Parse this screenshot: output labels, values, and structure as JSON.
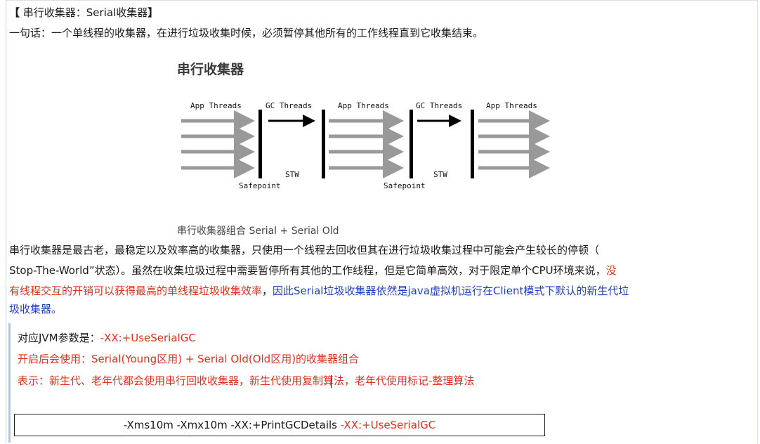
{
  "heading": {
    "bracket_open": "【",
    "text": " 串行收集器：Serial收集器",
    "bracket_close": "】"
  },
  "oneliner": "一句话：一个单线程的收集器，在进行垃圾收集时候，必须暂停其他所有的工作线程直到它收集结束。",
  "figure": {
    "title": "串行收集器",
    "caption": "串行收集器组合 Serial + Serial Old",
    "labels": {
      "app1": "App Threads",
      "gc1": "GC Threads",
      "app2": "App Threads",
      "gc2": "GC Threads",
      "app3": "App Threads",
      "stw1": "STW",
      "stw2": "STW",
      "safepoint1": "Safepoint",
      "safepoint2": "Safepoint"
    },
    "colors": {
      "app_arrow": "#999999",
      "gc_arrow": "#000000",
      "barrier": "#000000"
    }
  },
  "paragraph": {
    "line1": "串行收集器是最古老，最稳定以及效率高的收集器，只使用一个线程去回收但其在进行垃圾收集过程中可能会产生较长的停顿（",
    "line2_black": "Stop-The-World”状态）。虽然在收集垃圾过程中需要暂停所有其他的工作线程，但是它简单高效，对于限定单个CPU环境来说，",
    "line2_red": "没",
    "line3_red": "有线程交互的开销可以获得最高的单线程垃圾收集效率",
    "line3_black": "，",
    "line3_blue": "因此Serial垃圾收集器依然是java虚拟机运行在Client模式下默认的新生代垃",
    "line4_blue": "圾收集器。"
  },
  "jvm": {
    "param_label": "对应JVM参数是：",
    "param_value": "-XX:+UseSerialGC",
    "enabled_label": "开启后会使用：",
    "enabled_value": "Serial(Young区用) + Serial Old(Old区用)的收集器组合",
    "meaning": "表示：新生代、老年代都会使用串行回收收集器，新生代使用复制算法，老年代使用标记-整理算法"
  },
  "command": {
    "plain": "-Xms10m -Xmx10m -XX:+PrintGCDetails ",
    "highlight": "-XX:+UseSerialGC"
  },
  "colors": {
    "red": "#e0301e",
    "blue": "#1f3fc1"
  }
}
